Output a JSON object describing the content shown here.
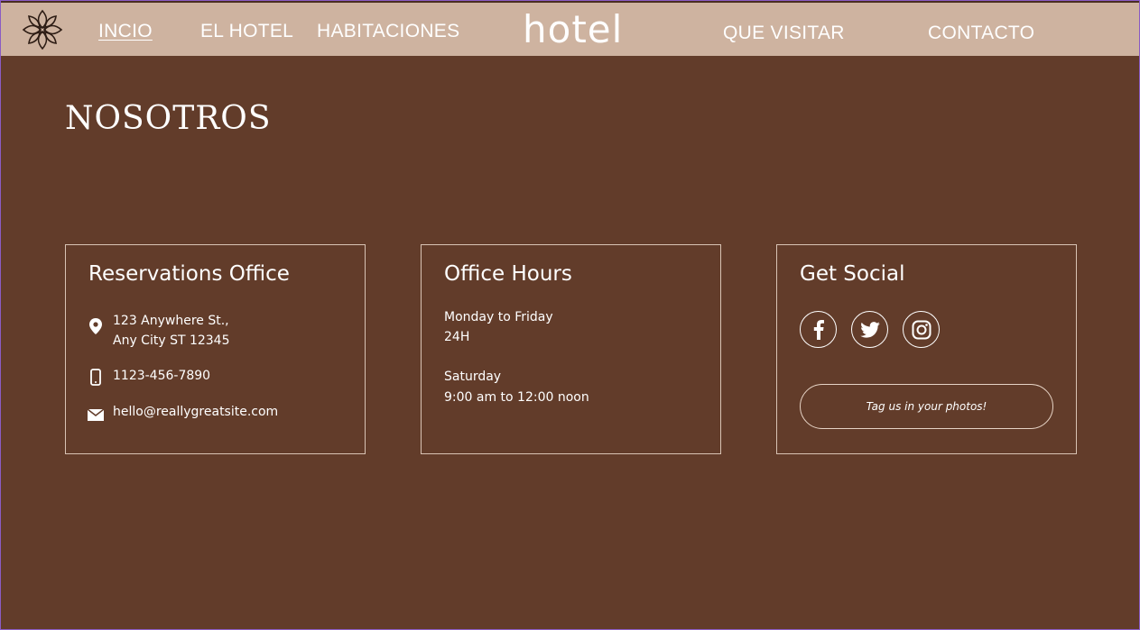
{
  "nav": {
    "links": [
      "INCIO",
      "EL HOTEL",
      "HABITACIONES",
      "QUE VISITAR",
      "CONTACTO"
    ],
    "brand": "hotel",
    "active": "INCIO"
  },
  "section": {
    "title": "NOSOTROS"
  },
  "reservations": {
    "title": "Reservations Office",
    "address_line1": "123 Anywhere St.,",
    "address_line2": "Any City ST 12345",
    "phone": "1123-456-7890",
    "email": "hello@reallygreatsite.com"
  },
  "hours": {
    "title": "Office Hours",
    "weekday_label": "Monday to Friday",
    "weekday_value": "24H",
    "saturday_label": "Saturday",
    "saturday_value": "9:00 am to 12:00 noon"
  },
  "social": {
    "title": "Get Social",
    "icons": [
      "facebook-icon",
      "twitter-icon",
      "instagram-icon"
    ],
    "tag_button": "Tag us in your photos!"
  },
  "colors": {
    "background": "#623c2a",
    "navbar": "#ceb3a0",
    "text": "#ffffff"
  }
}
